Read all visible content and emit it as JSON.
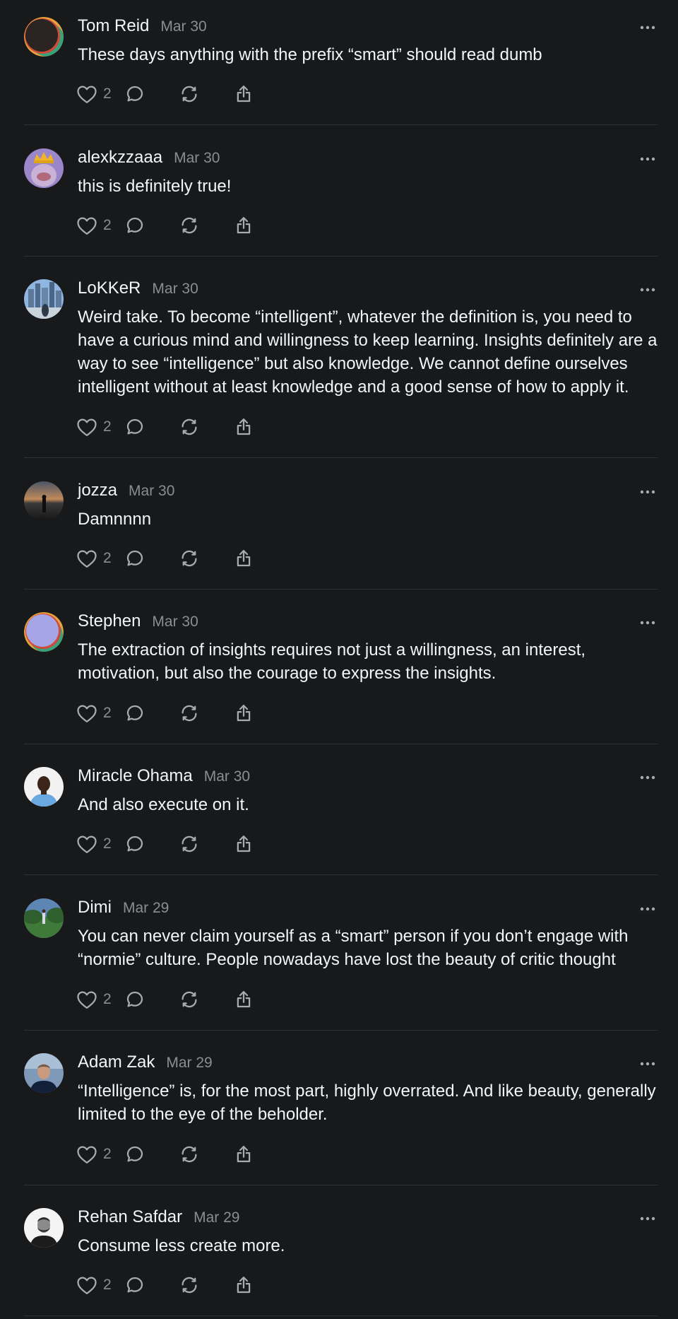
{
  "replies": [
    {
      "author": "Tom Reid",
      "date": "Mar 30",
      "text": "These days anything with the prefix “smart” should read dumb",
      "likes": "2",
      "avatar": "ring-avatar-orange"
    },
    {
      "author": "alexkzzaaa",
      "date": "Mar 30",
      "text": "this is definitely true!",
      "likes": "2",
      "avatar": "crowned-character-avatar"
    },
    {
      "author": "LoKKeR",
      "date": "Mar 30",
      "text": "Weird take. To become “intelligent”, whatever the definition is, you need to have a curious mind and willingness to keep learning. Insights definitely are a way to see “intelligence” but also knowledge. We cannot define ourselves intelligent without at least knowledge and a good sense of how to apply it.",
      "likes": "2",
      "avatar": "city-skyline-avatar"
    },
    {
      "author": "jozza",
      "date": "Mar 30",
      "text": "Damnnnn",
      "likes": "2",
      "avatar": "sunset-silhouette-avatar"
    },
    {
      "author": "Stephen",
      "date": "Mar 30",
      "text": "The extraction of insights requires not just a willingness, an interest, motivation, but also the courage to express the insights.",
      "likes": "2",
      "avatar": "ring-avatar-lavender"
    },
    {
      "author": "Miracle Ohama",
      "date": "Mar 30",
      "text": "And also execute on it.",
      "likes": "2",
      "avatar": "person-photo-avatar"
    },
    {
      "author": "Dimi",
      "date": "Mar 29",
      "text": "You can never claim yourself as a “smart” person if you don’t engage with “normie” culture. People nowadays have lost the beauty of critic thought",
      "likes": "2",
      "avatar": "field-landscape-avatar"
    },
    {
      "author": "Adam Zak",
      "date": "Mar 29",
      "text": "“Intelligence” is, for the most part, highly overrated. And like beauty, generally limited to the eye of the beholder.",
      "likes": "2",
      "avatar": "portrait-photo-avatar"
    },
    {
      "author": "Rehan Safdar",
      "date": "Mar 29",
      "text": "Consume less create more.",
      "likes": "2",
      "avatar": "bw-portrait-avatar"
    }
  ],
  "colors": {
    "background": "#18191b",
    "primary_text": "#f3f5f7",
    "secondary_text": "#8a8d91",
    "icon": "#a8abaf",
    "divider": "#2e3033"
  },
  "icons": {
    "like": "heart-icon",
    "comment": "comment-icon",
    "repost": "repost-icon",
    "share": "share-icon",
    "more": "more-options-icon"
  }
}
